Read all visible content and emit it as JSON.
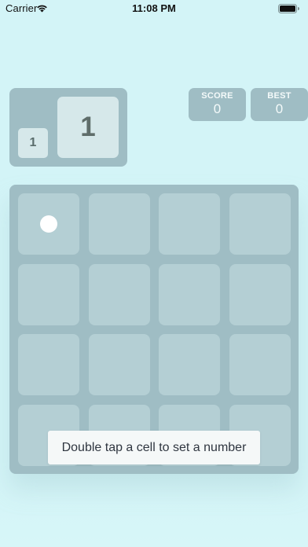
{
  "status_bar": {
    "carrier": "Carrier",
    "time": "11:08 PM",
    "wifi_icon": "wifi-icon",
    "battery_icon": "battery-icon"
  },
  "preview": {
    "next_small": "1",
    "next_large": "1"
  },
  "score": {
    "label": "SCORE",
    "value": "0"
  },
  "best": {
    "label": "BEST",
    "value": "0"
  },
  "board": {
    "rows": 4,
    "columns": 4,
    "marker": "dot"
  },
  "toast": {
    "message": "Double tap a cell to set a number"
  },
  "colors": {
    "background": "#d3f4f7",
    "panel": "#9fbdc4",
    "cell": "#b4cfd4",
    "tile": "#d6e8ea"
  }
}
